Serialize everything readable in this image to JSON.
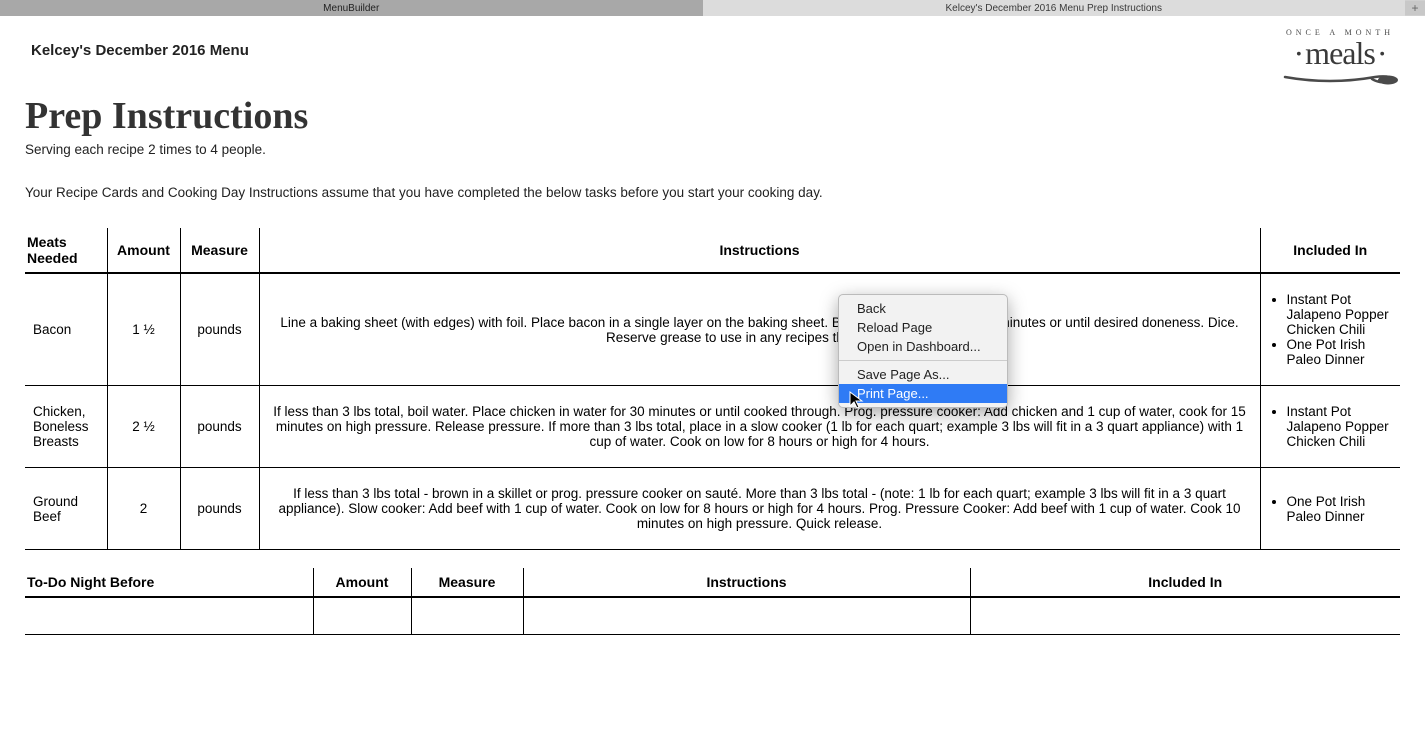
{
  "tabs": {
    "active": "MenuBuilder",
    "inactive": "Kelcey's December 2016 Menu Prep Instructions"
  },
  "menu_name": "Kelcey's December 2016 Menu",
  "title": "Prep Instructions",
  "serving": "Serving each recipe 2 times to 4 people.",
  "assume": "Your Recipe Cards and Cooking Day Instructions assume that you have completed the below tasks before you start your cooking day.",
  "logo": {
    "top": "ONCE A MONTH",
    "main": "meals"
  },
  "table1": {
    "headers": {
      "meats": "Meats Needed",
      "amount": "Amount",
      "measure": "Measure",
      "instructions": "Instructions",
      "included": "Included In"
    },
    "rows": [
      {
        "name": "Bacon",
        "amount": "1 ½",
        "measure": "pounds",
        "instructions": "Line a baking sheet (with edges) with foil. Place bacon in a single layer on the baking sheet. Bake at 375 degrees for 30 minutes or until desired doneness. Dice. Reserve grease to use in any recipes that call for it.",
        "included": [
          "Instant Pot Jalapeno Popper Chicken Chili",
          "One Pot Irish Paleo Dinner"
        ]
      },
      {
        "name": "Chicken, Boneless Breasts",
        "amount": "2 ½",
        "measure": "pounds",
        "instructions": "If less than 3 lbs total, boil water. Place chicken in water for 30 minutes or until cooked through. Prog. pressure cooker: Add chicken and 1 cup of water, cook for 15 minutes on high pressure. Release pressure. If more than 3 lbs total, place in a slow cooker (1 lb for each quart; example 3 lbs will fit in a 3 quart appliance) with 1 cup of water. Cook on low for 8 hours or high for 4 hours.",
        "included": [
          "Instant Pot Jalapeno Popper Chicken Chili"
        ]
      },
      {
        "name": "Ground Beef",
        "amount": "2",
        "measure": "pounds",
        "instructions": "If less than 3 lbs total - brown in a skillet or prog. pressure cooker on sauté. More than 3 lbs total - (note: 1 lb for each quart; example 3 lbs will fit in a 3 quart appliance). Slow cooker: Add beef with 1 cup of water. Cook on low for 8 hours or high for 4 hours. Prog. Pressure Cooker: Add beef with 1 cup of water. Cook 10 minutes on high pressure. Quick release.",
        "included": [
          "One Pot Irish Paleo Dinner"
        ]
      }
    ]
  },
  "table2": {
    "headers": {
      "todo": "To-Do Night Before",
      "amount": "Amount",
      "measure": "Measure",
      "instructions": "Instructions",
      "included": "Included In"
    }
  },
  "context_menu": {
    "items": [
      {
        "label": "Back"
      },
      {
        "label": "Reload Page"
      },
      {
        "label": "Open in Dashboard..."
      }
    ],
    "items2": [
      {
        "label": "Save Page As..."
      },
      {
        "label": "Print Page...",
        "highlight": true
      }
    ]
  }
}
